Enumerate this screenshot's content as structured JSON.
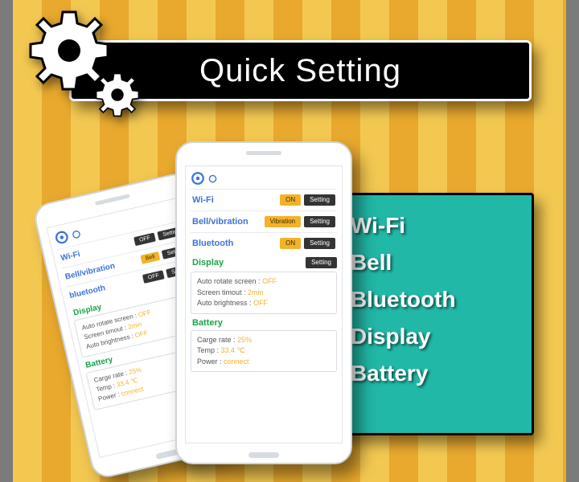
{
  "banner": {
    "title": "Quick Setting"
  },
  "features": {
    "prefix": "*",
    "items": [
      "Wi-Fi",
      "Bell",
      "Bluetooth",
      "Display",
      "Battery"
    ]
  },
  "buttons": {
    "on": "ON",
    "off": "OFF",
    "setting": "Setting",
    "vibration": "Vibration",
    "bell": "Bell"
  },
  "labels": {
    "wifi": "Wi-Fi",
    "bellvib": "Bell/vibration",
    "bluetooth_front": "Bluetooth",
    "bluetooth_back": "bluetooth",
    "display": "Display",
    "battery": "Battery"
  },
  "display_box": {
    "auto_rotate_k": "Auto rotate screen",
    "auto_rotate_v": "OFF",
    "timeout_k": "Screen timout",
    "timeout_v": "2min",
    "auto_bright_k": "Auto brightness",
    "auto_bright_v": "OFF"
  },
  "battery_box": {
    "cargo_k": "Carge rate",
    "cargo_v": "25%",
    "temp_k": "Temp",
    "temp_v": "33.4 ℃",
    "power_k": "Power",
    "power_v": "connect"
  },
  "colors": {
    "accent": "#22b8a7",
    "link": "#3d73d8",
    "green": "#1aa34a",
    "amber": "#f3b22b"
  }
}
